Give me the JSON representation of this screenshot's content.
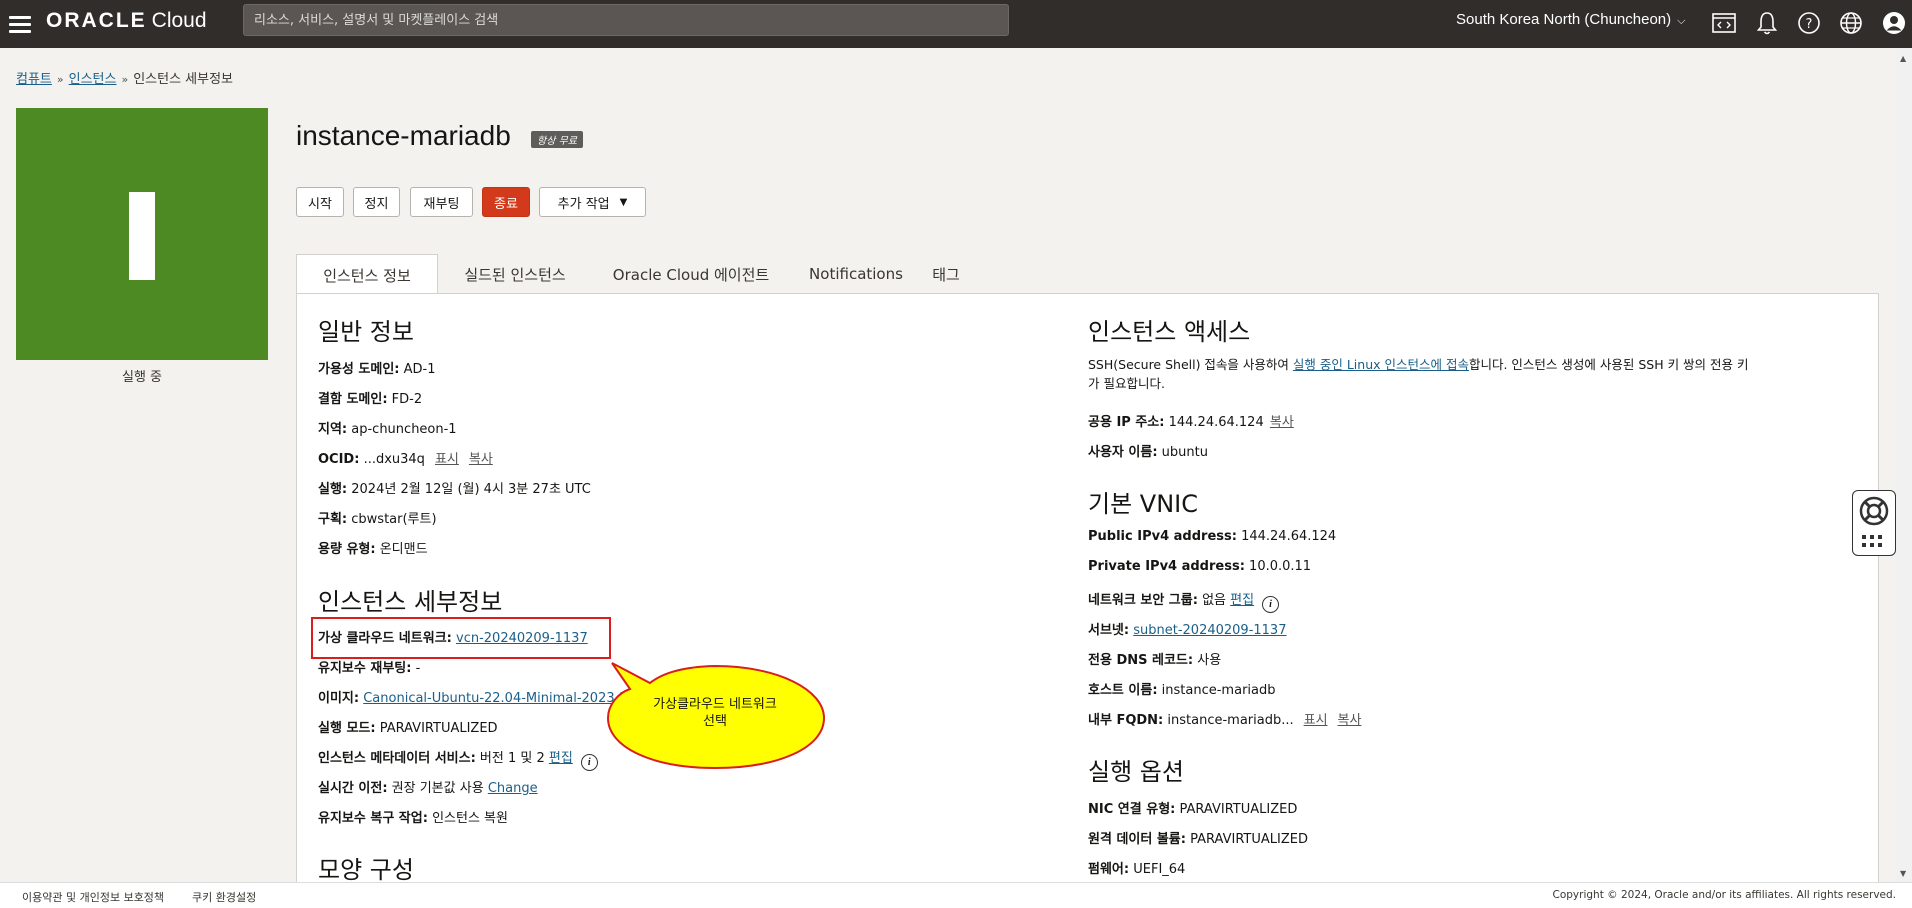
{
  "topbar": {
    "brand": "ORACLE",
    "brand_product": "Cloud",
    "search_placeholder": "리소스, 서비스, 설명서 및 마켓플레이스 검색",
    "region": "South Korea North (Chuncheon)",
    "icons": [
      "hamburger-icon",
      "code-editor-icon",
      "bell-icon",
      "help-icon",
      "globe-icon",
      "user-icon"
    ]
  },
  "breadcrumb": {
    "item1": "컴퓨트",
    "item2": "인스턴스",
    "current": "인스턴스 세부정보"
  },
  "instance": {
    "name": "instance-mariadb",
    "tag": "항상 무료",
    "state": "실행 중",
    "state_color": "#4d8a24"
  },
  "actions": {
    "start": "시작",
    "stop": "정지",
    "reboot": "재부팅",
    "terminate": "종료",
    "more": "추가 작업"
  },
  "tabs": [
    "인스턴스 정보",
    "실드된 인스턴스",
    "Oracle Cloud 에이전트",
    "Notifications",
    "태그"
  ],
  "general": {
    "heading": "일반 정보",
    "ad_label": "가용성 도메인:",
    "ad_value": "AD-1",
    "fd_label": "결함 도메인:",
    "fd_value": "FD-2",
    "region_label": "지역:",
    "region_value": "ap-chuncheon-1",
    "ocid_label": "OCID:",
    "ocid_value": "...dxu34q",
    "show": "표시",
    "copy": "복사",
    "launched_label": "실행:",
    "launched_value": "2024년 2월 12일 (월) 4시 3분 27초 UTC",
    "compartment_label": "구획:",
    "compartment_value": "cbwstar(루트)",
    "capacity_label": "용량 유형:",
    "capacity_value": "온디맨드"
  },
  "details": {
    "heading": "인스턴스 세부정보",
    "vcn_label": "가상 클라우드 네트워크:",
    "vcn_value": "vcn-20240209-1137",
    "maint_label": "유지보수 재부팅:",
    "maint_value": "-",
    "image_label": "이미지:",
    "image_value": "Canonical-Ubuntu-22.04-Minimal-2023.1",
    "mode_label": "실행 모드:",
    "mode_value": "PARAVIRTUALIZED",
    "imds_label": "인스턴스 메타데이터 서비스:",
    "imds_value": "버전 1 및 2",
    "imds_edit": "편집",
    "live_label": "실시간 이전:",
    "live_value": "권장 기본값 사용",
    "live_change": "Change",
    "recovery_label": "유지보수 복구 작업:",
    "recovery_value": "인스턴스 복원"
  },
  "shape": {
    "heading": "모양 구성"
  },
  "access": {
    "heading": "인스턴스 액세스",
    "desc1_pre": "SSH(Secure Shell) 접속을 사용하여 ",
    "desc1_link": "실행 중인 Linux 인스턴스에 접속",
    "desc1_post": "합니다. 인스턴스 생성에 사용된 SSH 키 쌍의 전용 키",
    "desc2": "가 필요합니다.",
    "ip_label": "공용 IP 주소:",
    "ip_value": "144.24.64.124",
    "copy": "복사",
    "user_label": "사용자 이름:",
    "user_value": "ubuntu"
  },
  "vnic": {
    "heading": "기본 VNIC",
    "pub_label": "Public IPv4 address:",
    "pub_value": "144.24.64.124",
    "priv_label": "Private IPv4 address:",
    "priv_value": "10.0.0.11",
    "nsg_label": "네트워크 보안 그룹:",
    "nsg_value": "없음",
    "nsg_edit": "편집",
    "subnet_label": "서브넷:",
    "subnet_value": "subnet-20240209-1137",
    "dns_label": "전용 DNS 레코드:",
    "dns_value": "사용",
    "host_label": "호스트 이름:",
    "host_value": "instance-mariadb",
    "fqdn_label": "내부 FQDN:",
    "fqdn_value": "instance-mariadb...",
    "show": "표시",
    "copy": "복사"
  },
  "launch": {
    "heading": "실행 옵션",
    "nic_label": "NIC 연결 유형:",
    "nic_value": "PARAVIRTUALIZED",
    "vol_label": "원격 데이터 볼륨:",
    "vol_value": "PARAVIRTUALIZED",
    "fw_label": "펌웨어:",
    "fw_value": "UEFI_64"
  },
  "annotation": {
    "text_line1": "가상클라우드 네트워크",
    "text_line2": "선택",
    "box_color": "#d91e1e",
    "bubble_color": "#ffff00"
  },
  "footer": {
    "terms": "이용약관 및 개인정보 보호정책",
    "cookies": "쿠키 환경설정",
    "copyright": "Copyright © 2024, Oracle and/or its affiliates. All rights reserved."
  }
}
